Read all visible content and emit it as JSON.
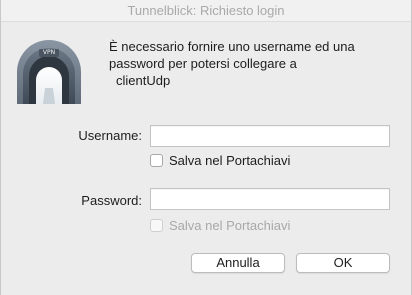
{
  "window": {
    "title": "Tunnelblick: Richiesto login"
  },
  "icon": {
    "name": "tunnelblick-vpn-icon",
    "badge": "VPN"
  },
  "message": {
    "line1": "È necessario fornire uno username ed una",
    "line2": "password per potersi collegare a",
    "line3": "clientUdp"
  },
  "form": {
    "username_label": "Username:",
    "username_value": "",
    "save_username_label": "Salva nel Portachiavi",
    "password_label": "Password:",
    "password_value": "",
    "save_password_label": "Salva nel Portachiavi"
  },
  "buttons": {
    "cancel": "Annulla",
    "ok": "OK"
  }
}
